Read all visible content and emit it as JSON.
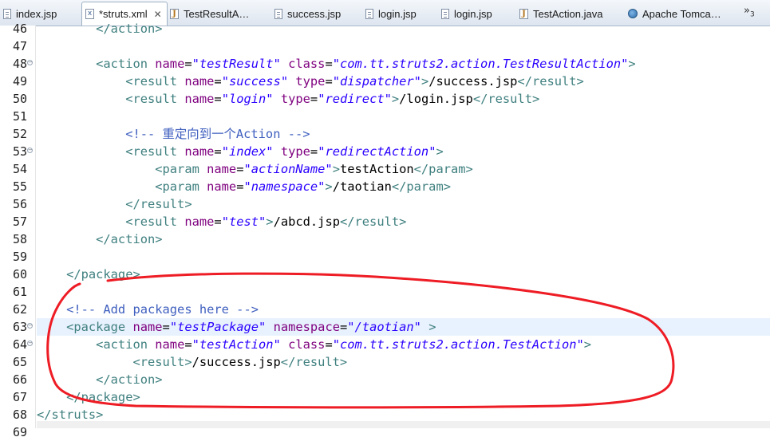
{
  "tabs": [
    {
      "label": "index.jsp",
      "icon": "jsp-file-icon",
      "kind": "doc"
    },
    {
      "label": "*struts.xml",
      "icon": "xml-file-icon",
      "kind": "xml",
      "active": true,
      "close": "✕"
    },
    {
      "label": "TestResultA…",
      "icon": "java-file-icon",
      "kind": "java"
    },
    {
      "label": "success.jsp",
      "icon": "jsp-file-icon",
      "kind": "doc"
    },
    {
      "label": "login.jsp",
      "icon": "jsp-file-icon",
      "kind": "doc"
    },
    {
      "label": "login.jsp",
      "icon": "jsp-file-icon",
      "kind": "doc"
    },
    {
      "label": "TestAction.java",
      "icon": "java-file-icon",
      "kind": "java"
    },
    {
      "label": "Apache Tomca…",
      "icon": "globe-icon",
      "kind": "globe"
    }
  ],
  "tab_overflow": {
    "label": "»",
    "count": "3"
  },
  "editor": {
    "current_line": "63",
    "lines": [
      {
        "n": "46",
        "fold": false,
        "tokens": [
          {
            "c": "tag",
            "t": "        </action>"
          }
        ]
      },
      {
        "n": "47",
        "fold": false,
        "tokens": []
      },
      {
        "n": "48",
        "fold": true,
        "tokens": [
          {
            "c": "tag",
            "t": "        <action "
          },
          {
            "c": "attr",
            "t": "name"
          },
          {
            "c": "txt",
            "t": "="
          },
          {
            "c": "val",
            "t": "\"testResult\""
          },
          {
            "c": "txt",
            "t": " "
          },
          {
            "c": "attr",
            "t": "class"
          },
          {
            "c": "txt",
            "t": "="
          },
          {
            "c": "val",
            "t": "\"com.tt.struts2.action.TestResultAction\""
          },
          {
            "c": "tag",
            "t": ">"
          }
        ]
      },
      {
        "n": "49",
        "fold": false,
        "tokens": [
          {
            "c": "tag",
            "t": "            <result "
          },
          {
            "c": "attr",
            "t": "name"
          },
          {
            "c": "txt",
            "t": "="
          },
          {
            "c": "val",
            "t": "\"success\""
          },
          {
            "c": "txt",
            "t": " "
          },
          {
            "c": "attr",
            "t": "type"
          },
          {
            "c": "txt",
            "t": "="
          },
          {
            "c": "val",
            "t": "\"dispatcher\""
          },
          {
            "c": "tag",
            "t": ">"
          },
          {
            "c": "txt",
            "t": "/success.jsp"
          },
          {
            "c": "tag",
            "t": "</result>"
          }
        ]
      },
      {
        "n": "50",
        "fold": false,
        "tokens": [
          {
            "c": "tag",
            "t": "            <result "
          },
          {
            "c": "attr",
            "t": "name"
          },
          {
            "c": "txt",
            "t": "="
          },
          {
            "c": "val",
            "t": "\"login\""
          },
          {
            "c": "txt",
            "t": " "
          },
          {
            "c": "attr",
            "t": "type"
          },
          {
            "c": "txt",
            "t": "="
          },
          {
            "c": "val",
            "t": "\"redirect\""
          },
          {
            "c": "tag",
            "t": ">"
          },
          {
            "c": "txt",
            "t": "/login.jsp"
          },
          {
            "c": "tag",
            "t": "</result>"
          }
        ]
      },
      {
        "n": "51",
        "fold": false,
        "tokens": []
      },
      {
        "n": "52",
        "fold": false,
        "tokens": [
          {
            "c": "cmt",
            "t": "            <!-- 重定向到一个Action -->"
          }
        ]
      },
      {
        "n": "53",
        "fold": true,
        "tokens": [
          {
            "c": "tag",
            "t": "            <result "
          },
          {
            "c": "attr",
            "t": "name"
          },
          {
            "c": "txt",
            "t": "="
          },
          {
            "c": "val",
            "t": "\"index\""
          },
          {
            "c": "txt",
            "t": " "
          },
          {
            "c": "attr",
            "t": "type"
          },
          {
            "c": "txt",
            "t": "="
          },
          {
            "c": "val",
            "t": "\"redirectAction\""
          },
          {
            "c": "tag",
            "t": ">"
          }
        ]
      },
      {
        "n": "54",
        "fold": false,
        "tokens": [
          {
            "c": "tag",
            "t": "                <param "
          },
          {
            "c": "attr",
            "t": "name"
          },
          {
            "c": "txt",
            "t": "="
          },
          {
            "c": "val",
            "t": "\"actionName\""
          },
          {
            "c": "tag",
            "t": ">"
          },
          {
            "c": "txt",
            "t": "testAction"
          },
          {
            "c": "tag",
            "t": "</param>"
          }
        ]
      },
      {
        "n": "55",
        "fold": false,
        "tokens": [
          {
            "c": "tag",
            "t": "                <param "
          },
          {
            "c": "attr",
            "t": "name"
          },
          {
            "c": "txt",
            "t": "="
          },
          {
            "c": "val",
            "t": "\"namespace\""
          },
          {
            "c": "tag",
            "t": ">"
          },
          {
            "c": "txt",
            "t": "/taotian"
          },
          {
            "c": "tag",
            "t": "</param>"
          }
        ]
      },
      {
        "n": "56",
        "fold": false,
        "tokens": [
          {
            "c": "tag",
            "t": "            </result>"
          }
        ]
      },
      {
        "n": "57",
        "fold": false,
        "tokens": [
          {
            "c": "tag",
            "t": "            <result "
          },
          {
            "c": "attr",
            "t": "name"
          },
          {
            "c": "txt",
            "t": "="
          },
          {
            "c": "val",
            "t": "\"test\""
          },
          {
            "c": "tag",
            "t": ">"
          },
          {
            "c": "txt",
            "t": "/abcd.jsp"
          },
          {
            "c": "tag",
            "t": "</result>"
          }
        ]
      },
      {
        "n": "58",
        "fold": false,
        "tokens": [
          {
            "c": "tag",
            "t": "        </action>"
          }
        ]
      },
      {
        "n": "59",
        "fold": false,
        "tokens": []
      },
      {
        "n": "60",
        "fold": false,
        "tokens": [
          {
            "c": "tag",
            "t": "    </package>"
          }
        ]
      },
      {
        "n": "61",
        "fold": false,
        "tokens": []
      },
      {
        "n": "62",
        "fold": false,
        "tokens": [
          {
            "c": "cmt",
            "t": "    <!-- Add packages here -->"
          }
        ]
      },
      {
        "n": "63",
        "fold": true,
        "tokens": [
          {
            "c": "tag",
            "t": "    <package "
          },
          {
            "c": "attr",
            "t": "name"
          },
          {
            "c": "txt",
            "t": "="
          },
          {
            "c": "val",
            "t": "\"testPackage\""
          },
          {
            "c": "txt",
            "t": " "
          },
          {
            "c": "attr",
            "t": "namespace"
          },
          {
            "c": "txt",
            "t": "="
          },
          {
            "c": "val",
            "t": "\"/taotian\""
          },
          {
            "c": "tag",
            "t": " >"
          }
        ]
      },
      {
        "n": "64",
        "fold": true,
        "tokens": [
          {
            "c": "tag",
            "t": "        <action "
          },
          {
            "c": "attr",
            "t": "name"
          },
          {
            "c": "txt",
            "t": "="
          },
          {
            "c": "val",
            "t": "\"testAction\""
          },
          {
            "c": "txt",
            "t": " "
          },
          {
            "c": "attr",
            "t": "class"
          },
          {
            "c": "txt",
            "t": "="
          },
          {
            "c": "val",
            "t": "\"com.tt.struts2.action.TestAction\""
          },
          {
            "c": "tag",
            "t": ">"
          }
        ]
      },
      {
        "n": "65",
        "fold": false,
        "tokens": [
          {
            "c": "tag",
            "t": "             <result>"
          },
          {
            "c": "txt",
            "t": "/success.jsp"
          },
          {
            "c": "tag",
            "t": "</result>"
          }
        ]
      },
      {
        "n": "66",
        "fold": false,
        "tokens": [
          {
            "c": "tag",
            "t": "        </action>"
          }
        ]
      },
      {
        "n": "67",
        "fold": false,
        "tokens": [
          {
            "c": "tag",
            "t": "    </package>"
          }
        ]
      },
      {
        "n": "68",
        "fold": false,
        "tokens": [
          {
            "c": "tag",
            "t": "</struts>"
          }
        ]
      },
      {
        "n": "69",
        "fold": false,
        "tokens": []
      }
    ]
  },
  "colors": {
    "tag": "#3f7f7f",
    "attr": "#7f007f",
    "value": "#2a00ff",
    "text": "#000000",
    "comment": "#3f5fbf",
    "annotation": "#ee1c24"
  }
}
